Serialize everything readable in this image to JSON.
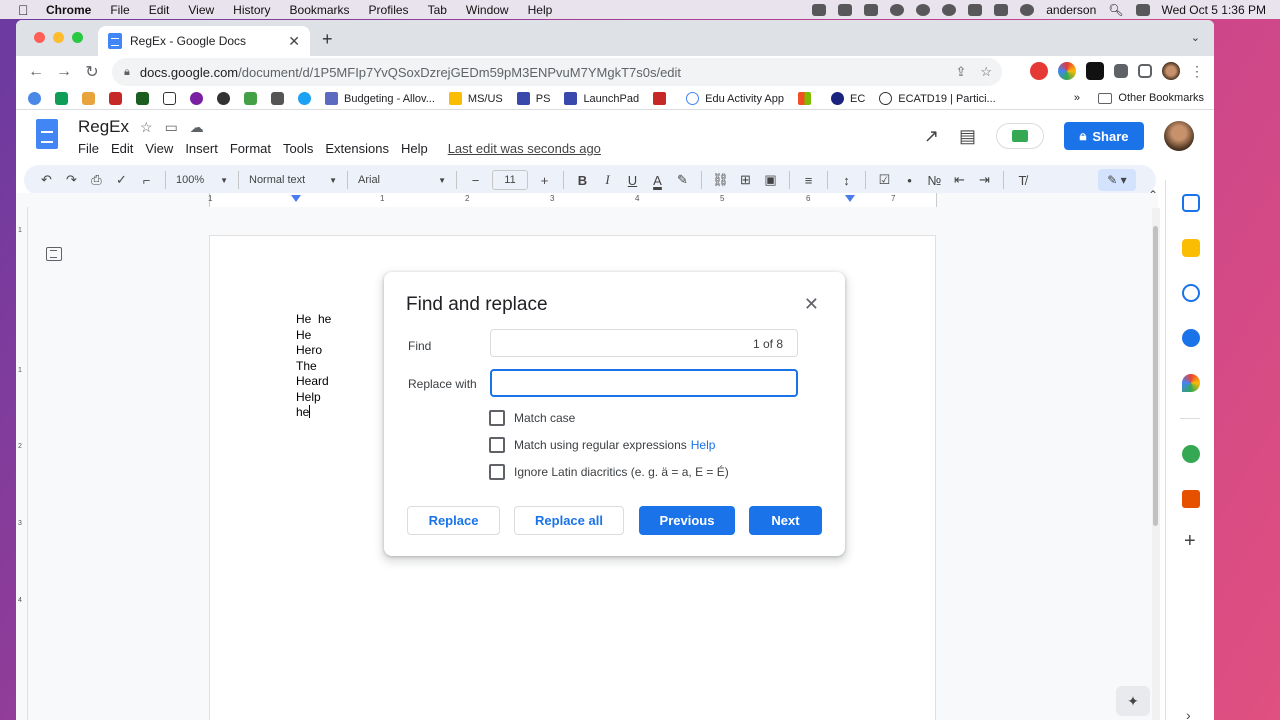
{
  "menubar": {
    "app_name": "Chrome",
    "items": [
      "File",
      "Edit",
      "View",
      "History",
      "Bookmarks",
      "Profiles",
      "Tab",
      "Window",
      "Help"
    ],
    "user": "anderson",
    "datetime": "Wed Oct 5  1:36 PM"
  },
  "browser": {
    "tab_title": "RegEx - Google Docs",
    "url_host": "docs.google.com",
    "url_path": "/document/d/1P5MFIp7YvQSoxDzrejGEDm59pM3ENPvuM7YMgkT7s0s/edit",
    "bookmarks": [
      "Budgeting - Allov...",
      "MS/US",
      "PS",
      "LaunchPad",
      "Edu Activity App",
      "EC",
      "ECATD19 | Partici..."
    ],
    "bookmarks_more": "»",
    "other_bookmarks": "Other Bookmarks"
  },
  "docs": {
    "title": "RegEx",
    "menu": [
      "File",
      "Edit",
      "View",
      "Insert",
      "Format",
      "Tools",
      "Extensions",
      "Help"
    ],
    "last_edit": "Last edit was seconds ago",
    "share_label": "Share"
  },
  "format_toolbar": {
    "zoom": "100%",
    "style": "Normal text",
    "font": "Arial",
    "font_size": "11"
  },
  "ruler": {
    "numbers": [
      "1",
      "1",
      "2",
      "3",
      "4",
      "5",
      "6",
      "7"
    ],
    "vertical_numbers": [
      "1",
      "1",
      "2",
      "3",
      "4"
    ]
  },
  "document": {
    "lines": [
      "He  he",
      "He",
      "Hero",
      "The",
      "Heard",
      "Help",
      "he"
    ]
  },
  "dialog": {
    "title": "Find and replace",
    "find_label": "Find",
    "find_value": "",
    "match_count": "1 of 8",
    "replace_label": "Replace with",
    "replace_value": "",
    "options": [
      {
        "label": "Match case",
        "checked": false
      },
      {
        "label": "Match using regular expressions",
        "link": "Help",
        "checked": false
      },
      {
        "label": "Ignore Latin diacritics (e. g. ä = a, E = É)",
        "checked": false
      }
    ],
    "buttons": {
      "replace": "Replace",
      "replace_all": "Replace all",
      "previous": "Previous",
      "next": "Next"
    }
  },
  "colors": {
    "accent": "#1a73e8",
    "toolbar_bg": "#edf2fa",
    "desktop": "#c04090"
  }
}
